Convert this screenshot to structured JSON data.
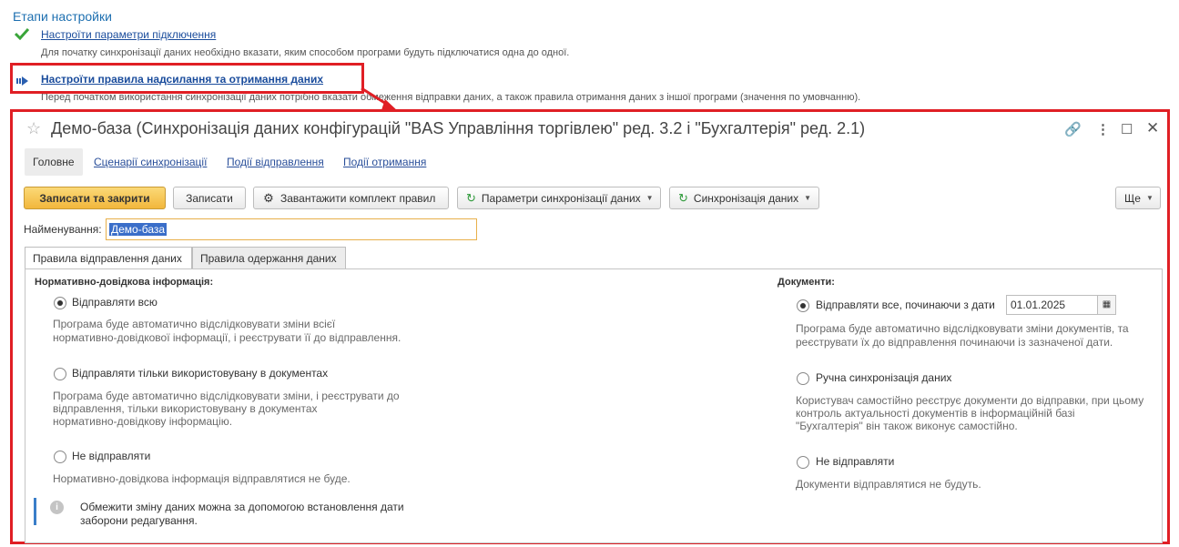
{
  "steps": {
    "title": "Етапи настройки",
    "items": [
      {
        "label": "Настроїти параметри підключення",
        "desc": "Для початку синхронізації даних необхідно вказати, яким способом програми будуть підключатися одна до одної.",
        "status": "check-icon"
      },
      {
        "label": "Настроїти правила надсилання та отримання даних",
        "desc": "Перед початком використання синхронізації даних потрібно вказати обмеження відправки даних, а також правила отримання даних з іншої програми (значення по умовчанню).",
        "status": "current-arrow-icon"
      }
    ]
  },
  "dialog": {
    "title": "Демо-база (Синхронізація даних конфігурацій \"BAS Управління торгівлею\" ред. 3.2 і \"Бухгалтерія\" ред. 2.1)",
    "nav": {
      "main": "Головне",
      "scenarios": "Сценарії синхронізації",
      "send_events": "Події відправлення",
      "receive_events": "Події отримання"
    },
    "toolbar": {
      "save_close": "Записати та закрити",
      "save": "Записати",
      "load_rules": "Завантажити комплект правил",
      "sync_params": "Параметри синхронізації даних",
      "sync": "Синхронізація даних",
      "more": "Ще"
    },
    "name_label": "Найменування:",
    "name_value": "Демо-база",
    "tabs": {
      "send_rules": "Правила відправлення даних",
      "receive_rules": "Правила одержання даних"
    },
    "left": {
      "title": "Нормативно-довідкова інформація:",
      "opt1": "Відправляти всю",
      "opt1_hint1": "Програма буде автоматично відслідковувати зміни всієї",
      "opt1_hint2": "нормативно-довідкової інформації, і реєструвати її до відправлення.",
      "opt2": "Відправляти тільки використовувану в документах",
      "opt2_hint1": "Програма буде автоматично відслідковувати зміни, і реєструвати до",
      "opt2_hint2": "відправлення, тільки використовувану в документах",
      "opt2_hint3": "нормативно-довідкову інформацію.",
      "opt3": "Не відправляти",
      "opt3_hint": "Нормативно-довідкова інформація відправлятися не буде.",
      "info1": "Обмежити зміну даних можна за допомогою встановлення дати",
      "info2": "заборони редагування."
    },
    "right": {
      "title": "Документи:",
      "opt1": "Відправляти все, починаючи з дати",
      "date": "01.01.2025",
      "opt1_hint1": "Програма буде автоматично відслідковувати зміни документів, та",
      "opt1_hint2": "реєструвати їх до відправлення починаючи із зазначеної дати.",
      "opt2": "Ручна синхронізація даних",
      "opt2_hint1": "Користувач самостійно реєструє документи до відправки, при цьому",
      "opt2_hint2": "контроль актуальності документів в інформаційній базі",
      "opt2_hint3": "\"Бухгалтерія\" він також виконує самостійно.",
      "opt3": "Не відправляти",
      "opt3_hint": "Документи відправлятися не будуть."
    }
  },
  "colors": {
    "highlight": "#e01f25",
    "link": "#1a4c9c",
    "accent": "#f2b73c"
  }
}
